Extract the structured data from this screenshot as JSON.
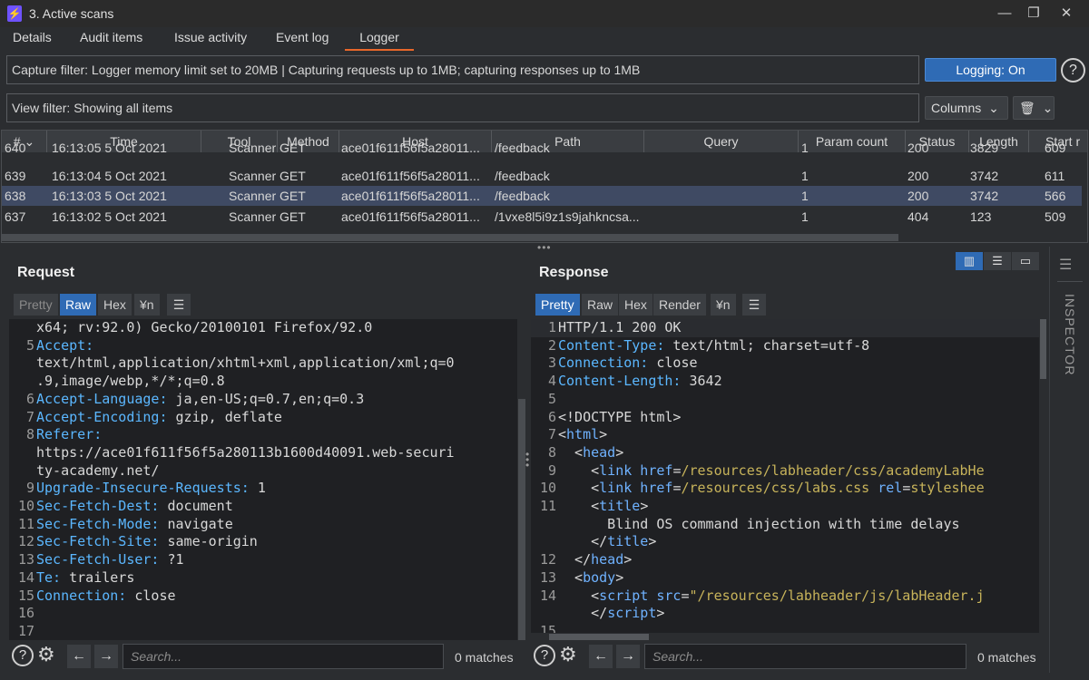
{
  "window": {
    "title": "3. Active scans",
    "minimize": "—",
    "restore": "❐",
    "close": "✕"
  },
  "tabs": [
    "Details",
    "Audit items",
    "Issue activity",
    "Event log",
    "Logger"
  ],
  "capture_filter": "Capture filter: Logger memory limit set to 20MB | Capturing requests up to 1MB;  capturing responses up to 1MB",
  "view_filter": "View filter: Showing all items",
  "logging_button": "Logging: On",
  "columns_button": "Columns",
  "table": {
    "headers": [
      "#",
      "Time",
      "Tool",
      "Method",
      "Host",
      "Path",
      "Query",
      "Param count",
      "Status",
      "Length",
      "Start r"
    ],
    "rows": [
      {
        "num": "640",
        "time": "16:13:05 5 Oct 2021",
        "tool": "Scanner",
        "method": "GET",
        "host": "ace01f611f56f5a28011...",
        "path": "/feedback",
        "query": "",
        "params": "1",
        "status": "200",
        "length": "3829",
        "start": "609"
      },
      {
        "num": "639",
        "time": "16:13:04 5 Oct 2021",
        "tool": "Scanner",
        "method": "GET",
        "host": "ace01f611f56f5a28011...",
        "path": "/feedback",
        "query": "",
        "params": "1",
        "status": "200",
        "length": "3742",
        "start": "611"
      },
      {
        "num": "638",
        "time": "16:13:03 5 Oct 2021",
        "tool": "Scanner",
        "method": "GET",
        "host": "ace01f611f56f5a28011...",
        "path": "/feedback",
        "query": "",
        "params": "1",
        "status": "200",
        "length": "3742",
        "start": "566"
      },
      {
        "num": "637",
        "time": "16:13:02 5 Oct 2021",
        "tool": "Scanner",
        "method": "GET",
        "host": "ace01f611f56f5a28011...",
        "path": "/1vxe8l5i9z1s9jahkncsa...",
        "query": "",
        "params": "1",
        "status": "404",
        "length": "123",
        "start": "509"
      }
    ]
  },
  "request": {
    "title": "Request",
    "tabs": [
      "Pretty",
      "Raw",
      "Hex",
      "¥n"
    ],
    "lines": [
      {
        "n": "",
        "k": "",
        "v": "x64; rv:92.0) Gecko/20100101 Firefox/92.0"
      },
      {
        "n": "5",
        "k": "Accept:",
        "v": ""
      },
      {
        "n": "",
        "k": "",
        "v": "text/html,application/xhtml+xml,application/xml;q=0"
      },
      {
        "n": "",
        "k": "",
        "v": ".9,image/webp,*/*;q=0.8"
      },
      {
        "n": "6",
        "k": "Accept-Language:",
        "v": " ja,en-US;q=0.7,en;q=0.3"
      },
      {
        "n": "7",
        "k": "Accept-Encoding:",
        "v": " gzip, deflate"
      },
      {
        "n": "8",
        "k": "Referer:",
        "v": ""
      },
      {
        "n": "",
        "k": "",
        "v": "https://ace01f611f56f5a280113b1600d40091.web-securi"
      },
      {
        "n": "",
        "k": "",
        "v": "ty-academy.net/"
      },
      {
        "n": "9",
        "k": "Upgrade-Insecure-Requests:",
        "v": " 1"
      },
      {
        "n": "10",
        "k": "Sec-Fetch-Dest:",
        "v": " document"
      },
      {
        "n": "11",
        "k": "Sec-Fetch-Mode:",
        "v": " navigate"
      },
      {
        "n": "12",
        "k": "Sec-Fetch-Site:",
        "v": " same-origin"
      },
      {
        "n": "13",
        "k": "Sec-Fetch-User:",
        "v": " ?1"
      },
      {
        "n": "14",
        "k": "Te:",
        "v": " trailers"
      },
      {
        "n": "15",
        "k": "Connection:",
        "v": " close"
      },
      {
        "n": "16",
        "k": "",
        "v": ""
      },
      {
        "n": "17",
        "k": "",
        "v": ""
      }
    ],
    "search_placeholder": "Search...",
    "matches": "0 matches"
  },
  "response": {
    "title": "Response",
    "tabs": [
      "Pretty",
      "Raw",
      "Hex",
      "Render",
      "¥n"
    ],
    "lines": [
      {
        "n": "1",
        "html": "<span class=\"v\">HTTP/1.1 200 OK</span>"
      },
      {
        "n": "2",
        "html": "<span class=\"k\">Content-Type:</span><span class=\"v\"> text/html; charset=utf-8</span>"
      },
      {
        "n": "3",
        "html": "<span class=\"k\">Connection:</span><span class=\"v\"> close</span>"
      },
      {
        "n": "4",
        "html": "<span class=\"k\">Content-Length:</span><span class=\"v\"> 3642</span>"
      },
      {
        "n": "5",
        "html": ""
      },
      {
        "n": "6",
        "html": "<span class=\"v\">&lt;!DOCTYPE html&gt;</span>"
      },
      {
        "n": "7",
        "html": "<span class=\"v\">&lt;</span><span class=\"tag\">html</span><span class=\"v\">&gt;</span>"
      },
      {
        "n": "8",
        "html": "<span class=\"v\">  &lt;</span><span class=\"tag\">head</span><span class=\"v\">&gt;</span>"
      },
      {
        "n": "9",
        "html": "<span class=\"v\">    &lt;</span><span class=\"tag\">link</span><span class=\"attr\"> href</span><span class=\"v\">=</span><span class=\"str\">/resources/labheader/css/academyLabHe</span>"
      },
      {
        "n": "10",
        "html": "<span class=\"v\">    &lt;</span><span class=\"tag\">link</span><span class=\"attr\"> href</span><span class=\"v\">=</span><span class=\"str\">/resources/css/labs.css</span><span class=\"attr\"> rel</span><span class=\"v\">=</span><span class=\"str\">styleshee</span>"
      },
      {
        "n": "11",
        "html": "<span class=\"v\">    &lt;</span><span class=\"tag\">title</span><span class=\"v\">&gt;</span>"
      },
      {
        "n": "",
        "html": "<span class=\"v\">      Blind OS command injection with time delays</span>"
      },
      {
        "n": "",
        "html": "<span class=\"v\">    &lt;/</span><span class=\"tag\">title</span><span class=\"v\">&gt;</span>"
      },
      {
        "n": "12",
        "html": "<span class=\"v\">  &lt;/</span><span class=\"tag\">head</span><span class=\"v\">&gt;</span>"
      },
      {
        "n": "13",
        "html": "<span class=\"v\">  &lt;</span><span class=\"tag\">body</span><span class=\"v\">&gt;</span>"
      },
      {
        "n": "14",
        "html": "<span class=\"v\">    &lt;</span><span class=\"tag\">script</span><span class=\"attr\"> src</span><span class=\"v\">=</span><span class=\"str\">\"/resources/labheader/js/labHeader.j</span>"
      },
      {
        "n": "",
        "html": "<span class=\"v\">    &lt;/</span><span class=\"tag\">script</span><span class=\"v\">&gt;</span>"
      },
      {
        "n": "15",
        "html": ""
      }
    ],
    "search_placeholder": "Search...",
    "matches": "0 matches"
  },
  "inspector_label": "INSPECTOR",
  "colors": {
    "accent_orange": "#e8672a",
    "accent_blue": "#2f6bb5",
    "selected_row": "#3f4a63",
    "editor_bg": "#1f2023"
  }
}
